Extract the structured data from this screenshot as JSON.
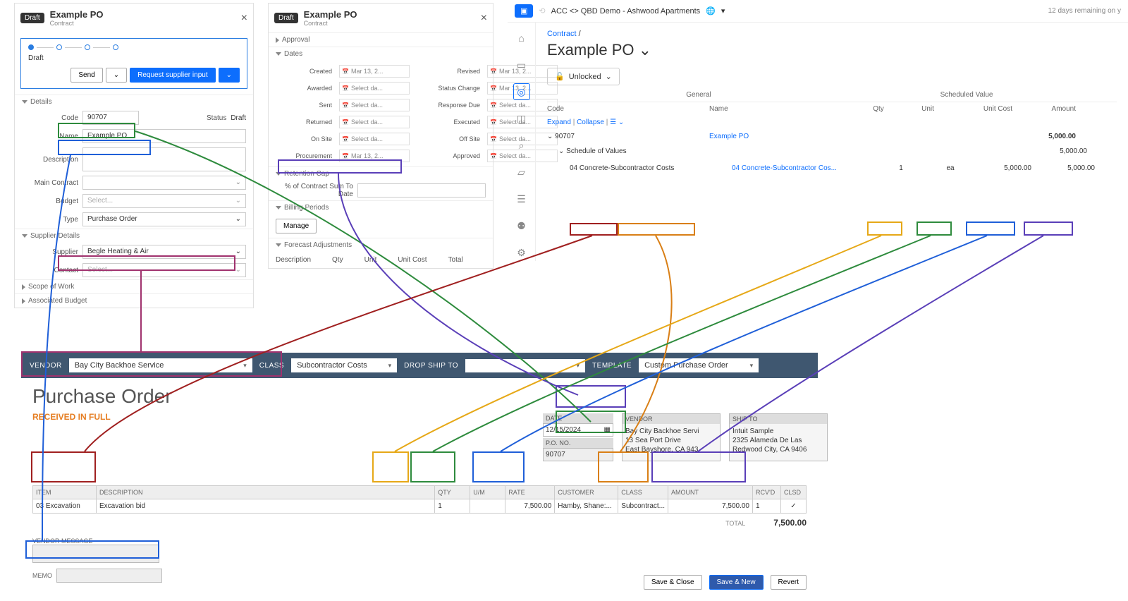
{
  "panel1": {
    "badge": "Draft",
    "title": "Example PO",
    "sub": "Contract",
    "stepLabel": "Draft",
    "sendBtn": "Send",
    "reqBtn": "Request supplier input",
    "detailsHdr": "Details",
    "codeLabel": "Code",
    "codeVal": "90707",
    "statusLabel": "Status",
    "statusVal": "Draft",
    "nameLabel": "Name",
    "nameVal": "Example PO",
    "descLabel": "Description",
    "mainContractLabel": "Main Contract",
    "budgetLabel": "Budget",
    "budgetPh": "Select...",
    "typeLabel": "Type",
    "typeVal": "Purchase Order",
    "supplierHdr": "Supplier Details",
    "supplierLabel": "Supplier",
    "supplierVal": "Begle Heating & Air",
    "contactLabel": "Contact",
    "contactPh": "Select...",
    "scopeHdr": "Scope of Work",
    "assocHdr": "Associated Budget"
  },
  "panel2": {
    "badge": "Draft",
    "title": "Example PO",
    "sub": "Contract",
    "approvalHdr": "Approval",
    "datesHdr": "Dates",
    "createdL": "Created",
    "createdV": "Mar 13, 2...",
    "revisedL": "Revised",
    "revisedV": "Mar 13, 2...",
    "awardedL": "Awarded",
    "awardedV": "Select da...",
    "statusChL": "Status Change",
    "statusChV": "Mar 13, 2...",
    "sentL": "Sent",
    "sentV": "Select da...",
    "respDueL": "Response Due",
    "respDueV": "Select da...",
    "returnedL": "Returned",
    "returnedV": "Select da...",
    "executedL": "Executed",
    "executedV": "Select da...",
    "onSiteL": "On Site",
    "onSiteV": "Select da...",
    "offSiteL": "Off Site",
    "offSiteV": "Select da...",
    "procL": "Procurement",
    "procV": "Mar 13, 2...",
    "approvedL": "Approved",
    "approvedV": "Select da...",
    "retentionHdr": "Retention Cap",
    "pctLabel": "% of Contract Sum To Date",
    "billingHdr": "Billing Periods",
    "manageBtn": "Manage",
    "forecastHdr": "Forecast Adjustments",
    "fcDesc": "Description",
    "fcQty": "Qty",
    "fcUnit": "Unit",
    "fcUC": "Unit Cost",
    "fcTotal": "Total"
  },
  "right": {
    "project": "ACC <> QBD Demo - Ashwood Apartments",
    "trial": "12 days remaining on y",
    "breadcrumb": "Contract",
    "slash": "/",
    "title": "Example PO",
    "lock": "Unlocked",
    "general": "General",
    "sched": "Scheduled Value",
    "codeH": "Code",
    "nameH": "Name",
    "qtyH": "Qty",
    "unitH": "Unit",
    "ucH": "Unit Cost",
    "amtH": "Amount",
    "expand": "Expand",
    "collapse": "Collapse",
    "row1Code": "90707",
    "row1Name": "Example PO",
    "row1Amt": "5,000.00",
    "sov": "Schedule of Values",
    "sovAmt": "5,000.00",
    "itemCode1": "04 Concrete",
    "itemCode2": "Subcontractor Costs",
    "itemName": "04 Concrete-Subcontractor Cos...",
    "itemQty": "1",
    "itemUnit": "ea",
    "itemUC": "5,000.00",
    "itemAmt": "5,000.00"
  },
  "qb": {
    "vendorL": "VENDOR",
    "vendorV": "Bay City Backhoe Service",
    "classL": "CLASS",
    "classV": "Subcontractor Costs",
    "dropL": "DROP SHIP TO",
    "tmplL": "TEMPLATE",
    "tmplV": "Custom Purchase Order",
    "title": "Purchase Order",
    "status": "RECEIVED IN FULL",
    "dateL": "DATE",
    "dateV": "12/15/2024",
    "poNoL": "P.O. NO.",
    "poNoV": "90707",
    "vendCardH": "VENDOR",
    "vendCard1": "Bay City Backhoe Servi",
    "vendCard2": "13 Sea Port Drive",
    "vendCard3": "East Bayshore, CA 943",
    "shipCardH": "SHIP TO",
    "shipCard1": "Intuit Sample",
    "shipCard2": "2325 Alameda De Las",
    "shipCard3": "Redwood City, CA 9406",
    "thItem": "ITEM",
    "thDesc": "DESCRIPTION",
    "thQty": "QTY",
    "thUM": "U/M",
    "thRate": "RATE",
    "thCust": "CUSTOMER",
    "thClass": "CLASS",
    "thAmt": "AMOUNT",
    "thRcvd": "RCV'D",
    "thClsd": "CLSD",
    "tdItem": "03 Excavation",
    "tdDesc": "Excavation bid",
    "tdQty": "1",
    "tdRate": "7,500.00",
    "tdCust": "Hamby, Shane:...",
    "tdClass": "Subcontract...",
    "tdAmt": "7,500.00",
    "tdRcvd": "1",
    "totalL": "TOTAL",
    "totalV": "7,500.00",
    "vmsgL": "VENDOR MESSAGE",
    "memoL": "MEMO",
    "saveClose": "Save & Close",
    "saveNew": "Save & New",
    "revert": "Revert"
  }
}
